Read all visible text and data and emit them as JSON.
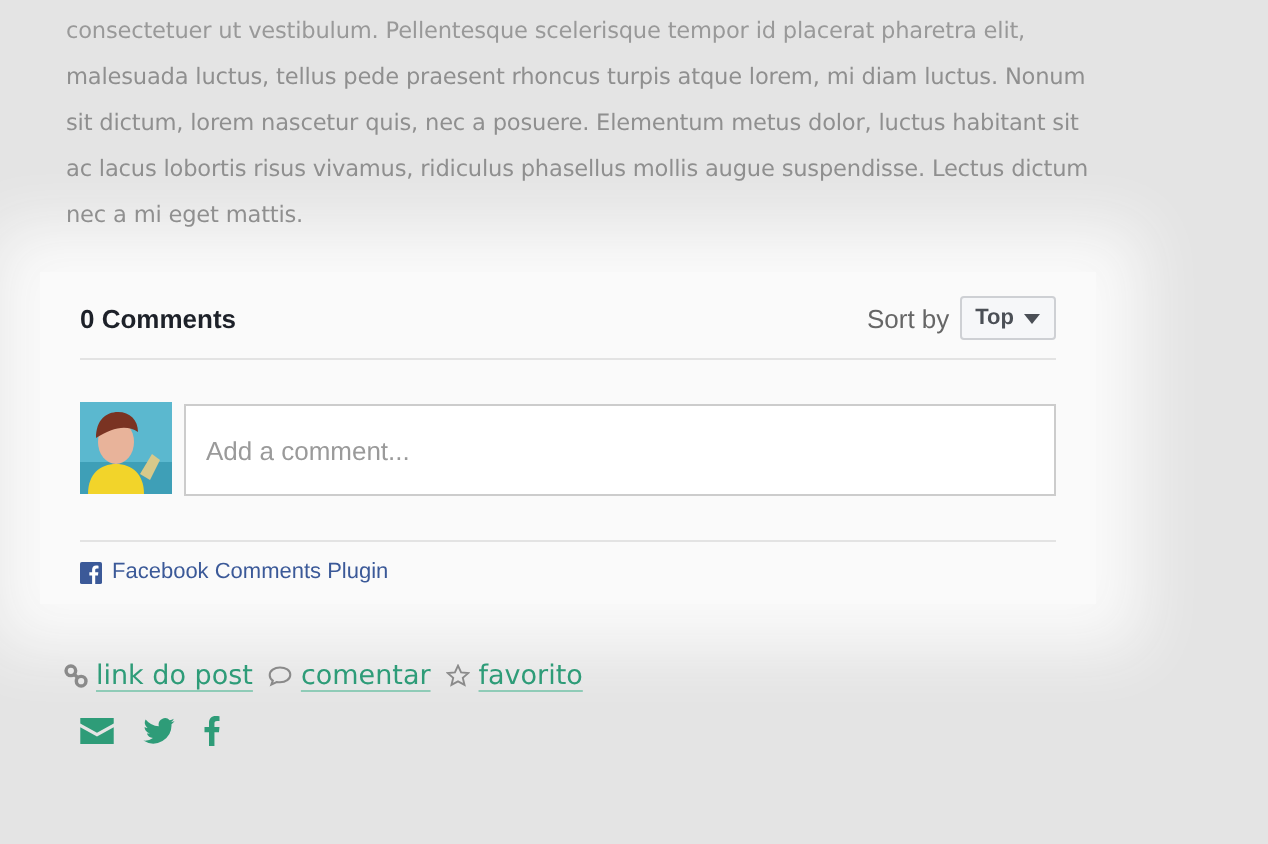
{
  "article": {
    "paragraph_lines": [
      "consectetuer ut vestibulum. Pellentesque scelerisque tempor id placerat pharetra elit,",
      "malesuada luctus, tellus pede praesent rhoncus turpis atque lorem, mi diam luctus. Nonum",
      "sit dictum, lorem nascetur quis, nec a posuere. Elementum metus dolor, luctus habitant sit",
      "ac lacus lobortis risus vivamus, ridiculus phasellus mollis augue suspendisse. Lectus dictum",
      "nec a mi eget mattis."
    ]
  },
  "comments": {
    "count_label": "0 Comments",
    "sort_label": "Sort by",
    "sort_value": "Top",
    "placeholder": "Add a comment...",
    "plugin_label": "Facebook Comments Plugin"
  },
  "post_links": [
    {
      "kind": "link",
      "label": "link do post"
    },
    {
      "kind": "comment",
      "label": "comentar"
    },
    {
      "kind": "star",
      "label": "favorito"
    }
  ],
  "share_icons": [
    {
      "kind": "mail"
    },
    {
      "kind": "twitter"
    },
    {
      "kind": "facebook"
    }
  ]
}
